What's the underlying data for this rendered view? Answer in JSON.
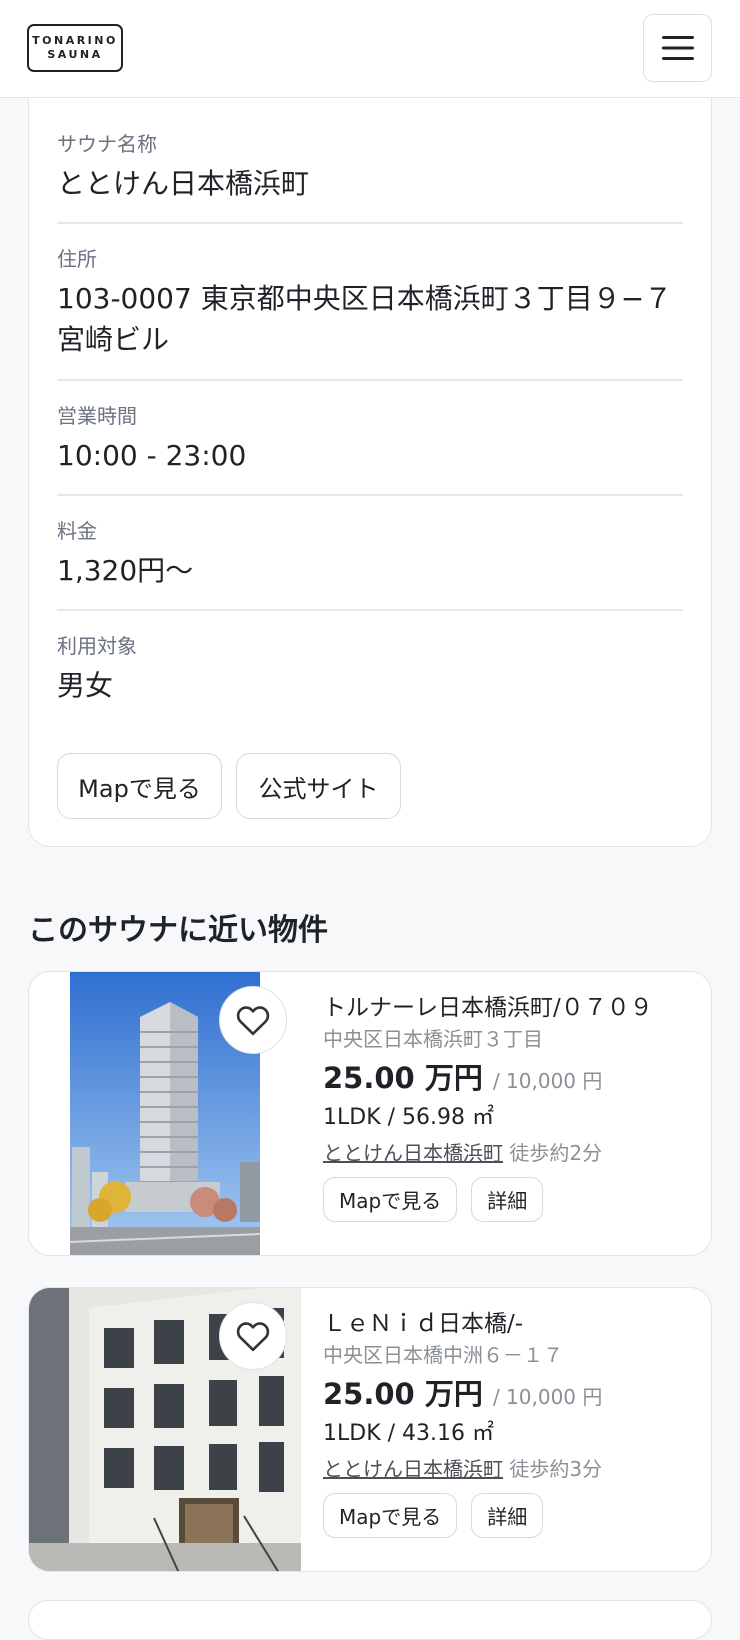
{
  "header": {
    "logo_line1": "TONARINO",
    "logo_line2": "SAUNA"
  },
  "sauna": {
    "name_label": "サウナ名称",
    "name_value": "ととけん日本橋浜町",
    "address_label": "住所",
    "address_value": "103-0007 東京都中央区日本橋浜町３丁目９−７ 宮崎ビル",
    "hours_label": "営業時間",
    "hours_value": "10:00 - 23:00",
    "price_label": "料金",
    "price_value": "1,320円〜",
    "target_label": "利用対象",
    "target_value": "男女",
    "map_button": "Mapで見る",
    "official_button": "公式サイト"
  },
  "nearby": {
    "title": "このサウナに近い物件",
    "properties": [
      {
        "title": "トルナーレ日本橋浜町/０７０９",
        "address": "中央区日本橋浜町３丁目",
        "price": "25.00 万円",
        "fee": "/ 10,000 円",
        "spec": "1LDK / 56.98 ㎡",
        "station_link": "ととけん日本橋浜町",
        "walk": "徒歩約2分",
        "map_button": "Mapで見る",
        "detail_button": "詳細"
      },
      {
        "title": "ＬｅＮｉｄ日本橋/-",
        "address": "中央区日本橋中洲６－１７",
        "price": "25.00 万円",
        "fee": "/ 10,000 円",
        "spec": "1LDK / 43.16 ㎡",
        "station_link": "ととけん日本橋浜町",
        "walk": "徒歩約3分",
        "map_button": "Mapで見る",
        "detail_button": "詳細"
      }
    ]
  },
  "icons": {
    "menu": "hamburger-menu-icon",
    "favorite": "heart-icon"
  }
}
